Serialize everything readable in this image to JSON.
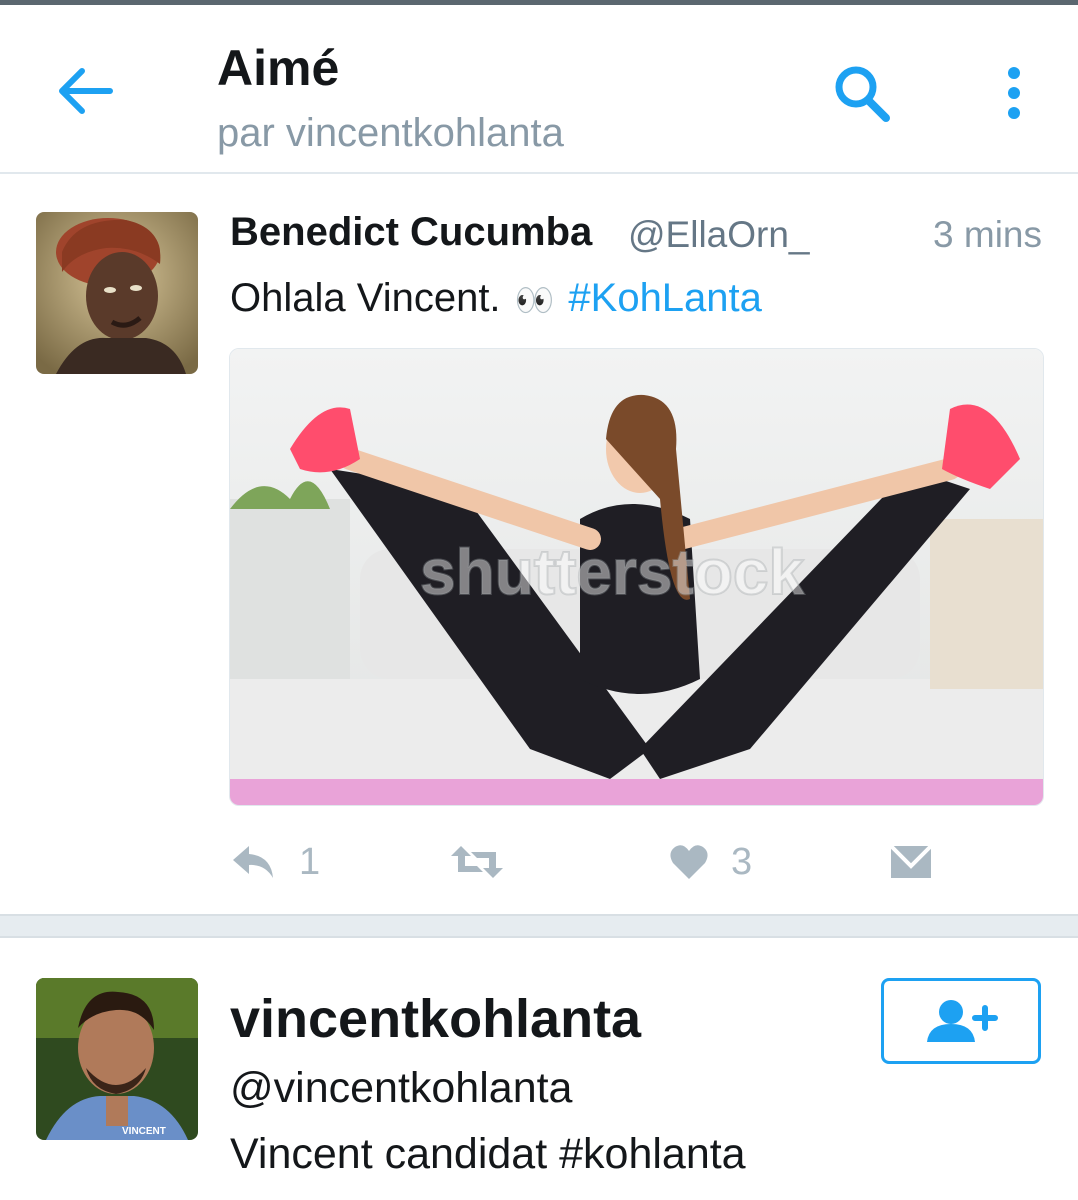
{
  "header": {
    "title": "Aimé",
    "subtitle": "par vincentkohlanta",
    "back_icon": "arrow-left-icon",
    "search_icon": "search-icon",
    "more_icon": "more-vertical-icon"
  },
  "tweet": {
    "author_name": "Benedict Cucumba",
    "author_handle": "@EllaOrn_",
    "time": "3 mins",
    "text_main": "Ohlala Vincent.",
    "text_emoji": "👀",
    "text_hashtag": "#KohLanta",
    "media_watermark": "shutterstock",
    "reply_count": "1",
    "like_count": "3"
  },
  "user": {
    "name": "vincentkohlanta",
    "handle": "@vincentkohlanta",
    "bio": "Vincent candidat #kohlanta",
    "avatar_caption": "VINCENT",
    "follow_icon": "add-user-icon"
  },
  "colors": {
    "accent": "#1da1f2",
    "muted": "#8899a6",
    "action_gray": "#aab8c2"
  }
}
